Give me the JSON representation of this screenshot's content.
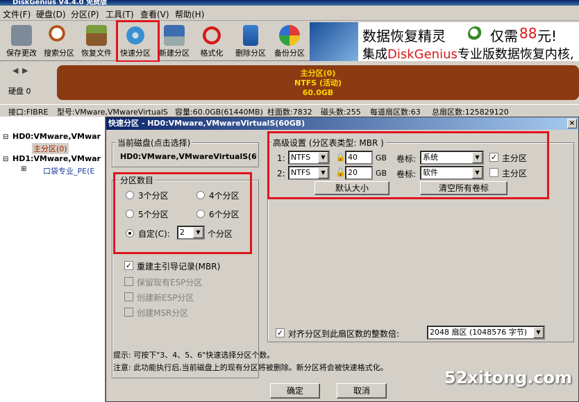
{
  "window": {
    "title": "DiskGenius V4.4.0 免费版"
  },
  "menu": [
    "文件(F)",
    "硬盘(D)",
    "分区(P)",
    "工具(T)",
    "查看(V)",
    "帮助(H)"
  ],
  "toolbar": [
    {
      "label": "保存更改",
      "icon": "save-icon"
    },
    {
      "label": "搜索分区",
      "icon": "magnifier-icon"
    },
    {
      "label": "恢复文件",
      "icon": "recover-box-icon"
    },
    {
      "label": "快速分区",
      "icon": "quick-partition-disk-icon"
    },
    {
      "label": "新建分区",
      "icon": "new-partition-laptop-icon"
    },
    {
      "label": "格式化",
      "icon": "format-icon"
    },
    {
      "label": "删除分区",
      "icon": "trash-icon"
    },
    {
      "label": "备份分区",
      "icon": "backup-pie-icon"
    }
  ],
  "banner": {
    "line1_a": "数据恢复精灵",
    "line1_b": "仅需",
    "price": "88",
    "line1_c": "元!",
    "line2_a": "集成",
    "line2_brand": "DiskGenius",
    "line2_b": "专业版数据恢复内核,"
  },
  "disk": {
    "label": "硬盘 0",
    "partition_name": "主分区(0)",
    "fs": "NTFS (活动)",
    "size": "60.0GB"
  },
  "info": {
    "iface": "接口:FIBRE",
    "model": "型号:VMware,VMwareVirtualS",
    "capacity": "容量:60.0GB(61440MB)",
    "cylinders": "柱面数:7832",
    "heads": "磁头数:255",
    "sectors": "每道扇区数:63",
    "total": "总扇区数:125829120"
  },
  "tree": {
    "hd0": "HD0:VMware,VMwar",
    "hd0_part": "主分区(0)",
    "hd1": "HD1:VMware,VMwar",
    "hd1_part": "口袋专业_PE(E"
  },
  "dialog": {
    "title": "快速分区 - HD0:VMware,VMwareVirtualS(60GB)",
    "close": "×",
    "current_disk_label": "当前磁盘(点击选择)",
    "current_disk_value": "HD0:VMware,VMwareVirtualS(6",
    "count_group": "分区数目",
    "r3": "3个分区",
    "r4": "4个分区",
    "r5": "5个分区",
    "r6": "6个分区",
    "custom": "自定(C):",
    "custom_value": "2",
    "custom_suffix": "个分区",
    "rebuild_mbr": "重建主引导记录(MBR)",
    "keep_esp": "保留现有ESP分区",
    "new_esp": "创建新ESP分区",
    "new_msr": "创建MSR分区",
    "adv_group": "高级设置 (分区表类型: MBR )",
    "rows": [
      {
        "idx": "1:",
        "fs": "NTFS",
        "size": "40",
        "unit": "GB",
        "vol_label": "卷标:",
        "vol": "系统",
        "primary": "主分区",
        "primary_checked": true
      },
      {
        "idx": "2:",
        "fs": "NTFS",
        "size": "20",
        "unit": "GB",
        "vol_label": "卷标:",
        "vol": "软件",
        "primary": "主分区",
        "primary_checked": false
      }
    ],
    "default_size_btn": "默认大小",
    "clear_labels_btn": "清空所有卷标",
    "align_label": "对齐分区到此扇区数的整数倍:",
    "align_value": "2048 扇区 (1048576 字节)",
    "hint1": "提示: 可按下\"3、4、5、6\"快速选择分区个数。",
    "hint2": "注意: 此功能执行后,当前磁盘上的现有分区将被删除。新分区将会被快速格式化。",
    "ok": "确定",
    "cancel": "取消"
  },
  "watermark": "52xitong.com"
}
